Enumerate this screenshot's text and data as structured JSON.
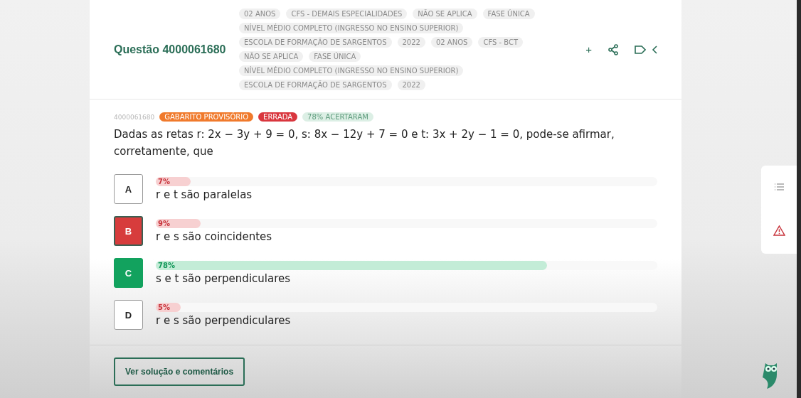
{
  "question": {
    "title": "Questão 4000061680",
    "tag_rows": [
      [
        "02 ANOS",
        "CFS - DEMAIS ESPECIALIDADES",
        "NÃO SE APLICA",
        "FASE ÚNICA"
      ],
      [
        "NÍVEL MÉDIO COMPLETO (INGRESSO NO ENSINO SUPERIOR)"
      ],
      [
        "ESCOLA DE FORMAÇÃO DE SARGENTOS",
        "2022",
        "02 ANOS",
        "CFS - BCT"
      ],
      [
        "NÃO SE APLICA",
        "FASE ÚNICA"
      ],
      [
        "NÍVEL MÉDIO COMPLETO (INGRESSO NO ENSINO SUPERIOR)"
      ],
      [
        "ESCOLA DE FORMAÇÃO DE SARGENTOS",
        "2022"
      ]
    ],
    "actions": [
      "+"
    ]
  },
  "meta": {
    "code": "4000061680",
    "badges": [
      {
        "label": "GABARITO PROVISÓRIO",
        "color": "#f07a2c"
      },
      {
        "label": "ERRADA",
        "color": "#d9363e"
      },
      {
        "label": "78% ACERTARAM",
        "color": "#dcefe5",
        "faded": true
      }
    ]
  },
  "statement": "Dadas as retas r: 2x − 3y + 9 = 0, s: 8x − 12y + 7 = 0 e t: 3x + 2y − 1 = 0, pode-se afirmar, corretamente, que",
  "options": [
    {
      "letter": "A",
      "text": "r e t são paralelas",
      "percent": "7%",
      "level": 0.07,
      "selected": false,
      "correct": false
    },
    {
      "letter": "B",
      "text": "r e s são coincidentes",
      "percent": "9%",
      "level": 0.09,
      "selected": true,
      "correct": false
    },
    {
      "letter": "C",
      "text": "s e t são perpendiculares",
      "percent": "78%",
      "level": 0.78,
      "selected": false,
      "correct": true
    },
    {
      "letter": "D",
      "text": "r e s são perpendiculares",
      "percent": "5%",
      "level": 0.05,
      "selected": false,
      "correct": false
    }
  ],
  "solution_button": "Ver solução e comentários"
}
